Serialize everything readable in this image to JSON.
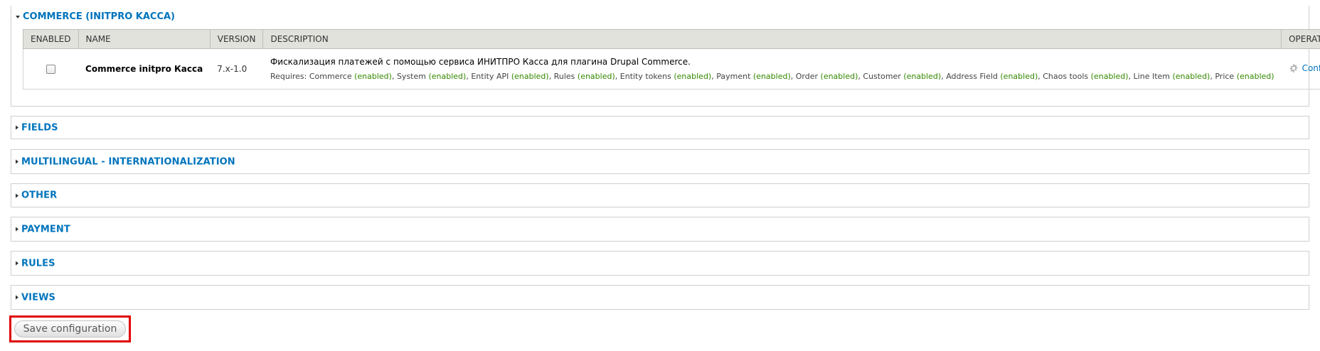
{
  "fieldsets": {
    "commerce": {
      "title": "COMMERCE (INITPRO KACCA)",
      "table": {
        "headers": [
          "ENABLED",
          "NAME",
          "VERSION",
          "DESCRIPTION",
          "OPERATIONS"
        ],
        "row": {
          "name": "Commerce initpro Касса",
          "version": "7.x-1.0",
          "description": "Фискализация платежей с помощью сервиса ИНИТПРО Касса для плагина Drupal Commerce.",
          "requires_label": "Requires:",
          "requires": [
            {
              "name": "Commerce",
              "status": "(enabled)"
            },
            {
              "name": "System",
              "status": "(enabled)"
            },
            {
              "name": "Entity API",
              "status": "(enabled)"
            },
            {
              "name": "Rules",
              "status": "(enabled)"
            },
            {
              "name": "Entity tokens",
              "status": "(enabled)"
            },
            {
              "name": "Payment",
              "status": "(enabled)"
            },
            {
              "name": "Order",
              "status": "(enabled)"
            },
            {
              "name": "Customer",
              "status": "(enabled)"
            },
            {
              "name": "Address Field",
              "status": "(enabled)"
            },
            {
              "name": "Chaos tools",
              "status": "(enabled)"
            },
            {
              "name": "Line Item",
              "status": "(enabled)"
            },
            {
              "name": "Price",
              "status": "(enabled)"
            }
          ],
          "operation": "Configure",
          "operation_icon": "gear-icon"
        }
      }
    },
    "collapsed": [
      "FIELDS",
      "MULTILINGUAL - INTERNATIONALIZATION",
      "OTHER",
      "PAYMENT",
      "RULES",
      "VIEWS"
    ]
  },
  "save_button": "Save configuration",
  "colors": {
    "link": "#0074bd",
    "enabled": "#348900",
    "highlight": "#e00000"
  }
}
